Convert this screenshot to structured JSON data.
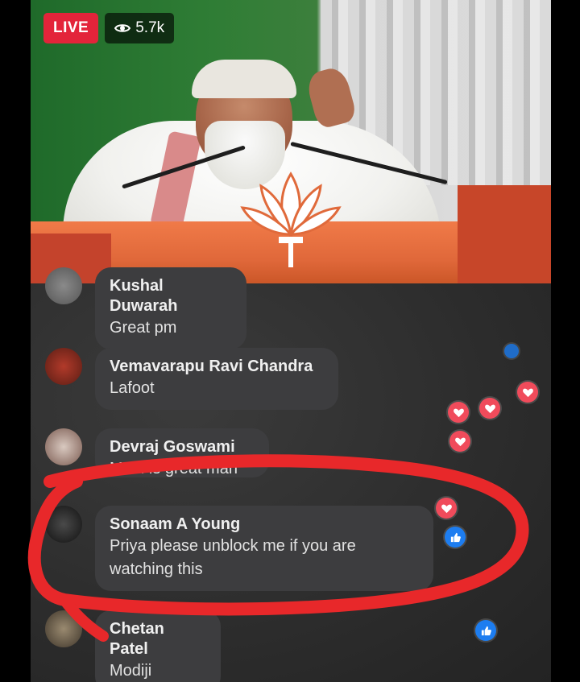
{
  "live_badge": "LIVE",
  "viewers": "5.7k",
  "comments": [
    {
      "name": "Kushal Duwarah",
      "text": "Great pm"
    },
    {
      "name": "Vemavarapu Ravi Chandra",
      "text": "Lafoot"
    },
    {
      "name": "Devraj Goswami",
      "text": "Modi is great man"
    },
    {
      "name": "Sonaam A Young",
      "text_line1": "Priya please unblock me if you are",
      "text_line2": "watching this"
    },
    {
      "name": "Chetan Patel",
      "text": "Modiji"
    }
  ],
  "colors": {
    "live": "#e3243a",
    "heart": "#f04b5b",
    "like": "#1d7df0",
    "annotation": "#e8282a"
  },
  "icons": [
    "eye-icon",
    "heart-reaction-icon",
    "like-reaction-icon"
  ]
}
